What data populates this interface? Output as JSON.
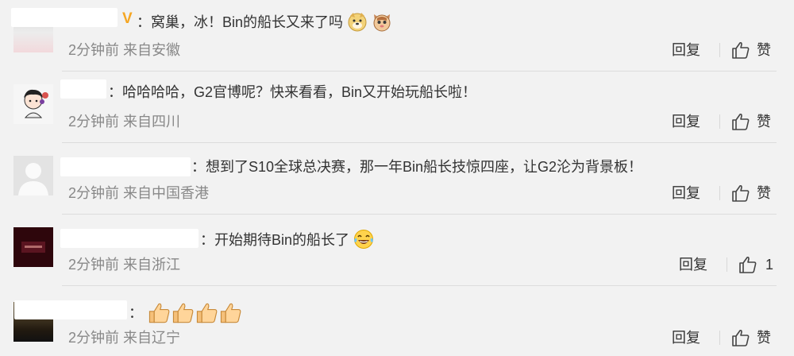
{
  "comments": [
    {
      "separator": "：",
      "text": "窝巢，冰！Bin的船长又来了吗",
      "emojis": [
        "doge-face-icon",
        "cat-face-icon"
      ],
      "vip_badge": "V",
      "meta": "2分钟前 来自安徽",
      "reply_label": "回复",
      "like_label": "赞"
    },
    {
      "separator": "：",
      "text": "哈哈哈哈，G2官博呢？快来看看，Bin又开始玩船长啦！",
      "emojis": [],
      "meta": "2分钟前 来自四川",
      "reply_label": "回复",
      "like_label": "赞"
    },
    {
      "separator": "：",
      "text": "想到了S10全球总决赛，那一年Bin船长技惊四座，让G2沦为背景板！",
      "emojis": [],
      "meta": "2分钟前 来自中国香港",
      "reply_label": "回复",
      "like_label": "赞"
    },
    {
      "separator": "：",
      "text": "开始期待Bin的船长了",
      "emojis": [
        "laugh-tears-icon"
      ],
      "meta": "2分钟前 来自浙江",
      "reply_label": "回复",
      "like_label": "1"
    },
    {
      "separator": "：",
      "text": "",
      "emojis": [
        "thumbs-up-icon",
        "thumbs-up-icon",
        "thumbs-up-icon",
        "thumbs-up-icon"
      ],
      "meta": "2分钟前 来自辽宁",
      "reply_label": "回复",
      "like_label": "赞"
    }
  ],
  "colors": {
    "background": "#f2f2f2",
    "text": "#333333",
    "meta": "#888888",
    "vip": "#f5a623"
  }
}
